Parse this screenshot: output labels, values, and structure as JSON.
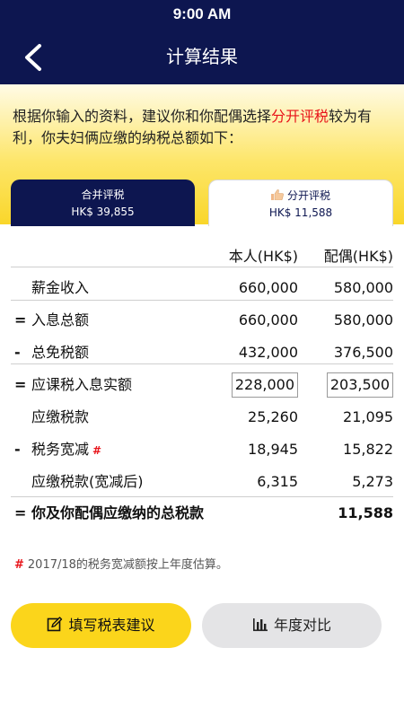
{
  "status_bar": {
    "time": "9:00 AM"
  },
  "nav": {
    "title": "计算结果"
  },
  "banner": {
    "text_before": "根据你输入的资料，建议你和你配偶选择",
    "highlight": "分开评税",
    "text_after": "较为有利，你夫妇俩应缴的纳税总额如下："
  },
  "tabs": [
    {
      "label": "合并评税",
      "amount": "HK$ 39,855"
    },
    {
      "label": "分开评税",
      "amount": "HK$ 11,588"
    }
  ],
  "table": {
    "headers": {
      "self": "本人(HK$)",
      "spouse": "配偶(HK$)"
    },
    "rows": [
      {
        "op": "",
        "label": "薪金收入",
        "self": "660,000",
        "spouse": "580,000"
      },
      {
        "op": "=",
        "label": "入息总额",
        "self": "660,000",
        "spouse": "580,000"
      },
      {
        "op": "-",
        "label": "总免税额",
        "self": "432,000",
        "spouse": "376,500"
      },
      {
        "op": "=",
        "label": "应课税入息实额",
        "self": "228,000",
        "spouse": "203,500"
      },
      {
        "op": "",
        "label": "应缴税款",
        "self": "25,260",
        "spouse": "21,095"
      },
      {
        "op": "-",
        "label": "税务宽减",
        "self": "18,945",
        "spouse": "15,822",
        "mark": "#"
      },
      {
        "op": "",
        "label": "应缴税款(宽减后)",
        "self": "6,315",
        "spouse": "5,273"
      }
    ],
    "total": {
      "op": "=",
      "label": "你及你配偶应缴纳的总税款",
      "value": "11,588"
    }
  },
  "note": {
    "mark": "#",
    "text": "2017/18的税务宽减额按上年度估算。"
  },
  "buttons": {
    "fill_form": "填写税表建议",
    "compare": "年度对比"
  },
  "colors": {
    "navy": "#0d1650",
    "yellow": "#fbd51b",
    "red": "#e8141a"
  },
  "icons": {
    "back": "chevron-left-icon",
    "thumb": "thumbs-up-icon",
    "edit": "edit-icon",
    "chart": "bar-chart-icon"
  }
}
